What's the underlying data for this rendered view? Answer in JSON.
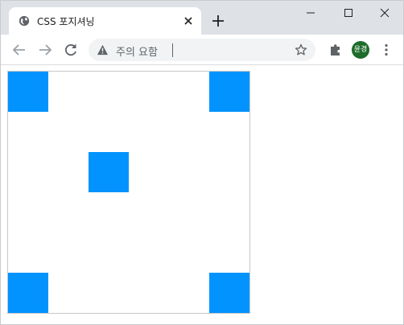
{
  "tab": {
    "title": "CSS 포지셔닝",
    "favicon": "globe-icon",
    "close_icon": "close-icon"
  },
  "window_controls": [
    "minimize-icon",
    "maximize-icon",
    "close-icon"
  ],
  "toolbar": {
    "back_icon": "arrow-left-icon",
    "forward_icon": "arrow-right-icon",
    "reload_icon": "reload-icon",
    "extensions_icon": "puzzle-icon",
    "menu_icon": "more-vertical-icon"
  },
  "omnibox": {
    "security_label": "주의 요함",
    "security_icon": "warning-icon",
    "value": "",
    "bookmark_icon": "star-icon"
  },
  "profile": {
    "initials": "윤경",
    "color": "#1e6b2a"
  },
  "page": {
    "box_color": "#0393ff",
    "container_border_color": "#c8c8c8"
  }
}
